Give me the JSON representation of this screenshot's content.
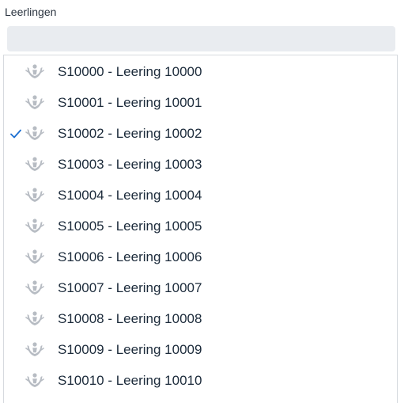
{
  "field": {
    "label": "Leerlingen",
    "search_value": ""
  },
  "dropdown": {
    "selected_index": 2,
    "options": [
      {
        "label": "S10000 - Leering 10000",
        "icon": "student-icon",
        "selected": false
      },
      {
        "label": "S10001 - Leering 10001",
        "icon": "student-icon",
        "selected": false
      },
      {
        "label": "S10002 - Leering 10002",
        "icon": "student-icon",
        "selected": true
      },
      {
        "label": "S10003 - Leering 10003",
        "icon": "student-icon",
        "selected": false
      },
      {
        "label": "S10004 - Leering 10004",
        "icon": "student-icon",
        "selected": false
      },
      {
        "label": "S10005 - Leering 10005",
        "icon": "student-icon",
        "selected": false
      },
      {
        "label": "S10006 - Leering 10006",
        "icon": "student-icon",
        "selected": false
      },
      {
        "label": "S10007 - Leering 10007",
        "icon": "student-icon",
        "selected": false
      },
      {
        "label": "S10008 - Leering 10008",
        "icon": "student-icon",
        "selected": false
      },
      {
        "label": "S10009 - Leering 10009",
        "icon": "student-icon",
        "selected": false
      },
      {
        "label": "S10010 - Leering 10010",
        "icon": "student-icon",
        "selected": false
      }
    ]
  },
  "colors": {
    "check": "#1c6fd1",
    "icon": "#b7bcc3",
    "search_bg": "#e9ecf0"
  }
}
